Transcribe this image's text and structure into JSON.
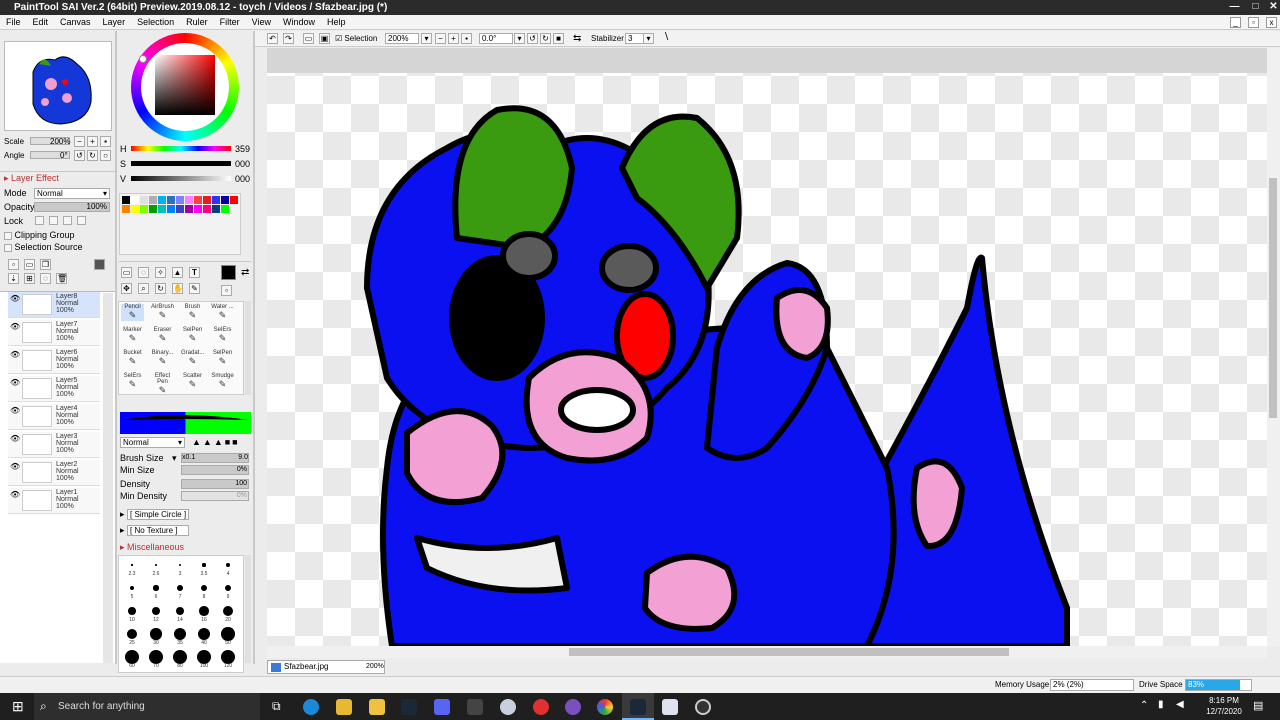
{
  "window": {
    "title": "PaintTool SAI Ver.2 (64bit) Preview.2019.08.12 - toych / Videos / Sfazbear.jpg (*)"
  },
  "menu": [
    "File",
    "Edit",
    "Canvas",
    "Layer",
    "Selection",
    "Ruler",
    "Filter",
    "View",
    "Window",
    "Help"
  ],
  "toolbar": {
    "selection_label": "Selection",
    "zoom": "200%",
    "rotation": "0.0°",
    "stabilizer_label": "Stabilizer",
    "stabilizer_value": "3"
  },
  "navigator": {
    "scale_label": "Scale",
    "scale_value": "200%",
    "angle_label": "Angle",
    "angle_value": "0°"
  },
  "layer_panel": {
    "layer_effect": "Layer Effect",
    "mode_label": "Mode",
    "mode_value": "Normal",
    "opacity_label": "Opacity",
    "opacity_value": "100%",
    "lock_label": "Lock",
    "clipping_group": "Clipping Group",
    "selection_source": "Selection Source",
    "layers": [
      {
        "name": "Layer8",
        "mode": "Normal",
        "opacity": "100%"
      },
      {
        "name": "Layer7",
        "mode": "Normal",
        "opacity": "100%"
      },
      {
        "name": "Layer6",
        "mode": "Normal",
        "opacity": "100%"
      },
      {
        "name": "Layer5",
        "mode": "Normal",
        "opacity": "100%"
      },
      {
        "name": "Layer4",
        "mode": "Normal",
        "opacity": "100%"
      },
      {
        "name": "Layer3",
        "mode": "Normal",
        "opacity": "100%"
      },
      {
        "name": "Layer2",
        "mode": "Normal",
        "opacity": "100%"
      },
      {
        "name": "Layer1",
        "mode": "Normal",
        "opacity": "100%"
      }
    ]
  },
  "color": {
    "h_label": "H",
    "h_value": "359",
    "s_label": "S",
    "s_value": "000",
    "v_label": "V",
    "v_value": "000"
  },
  "swatches": [
    "#000000",
    "#ffffff",
    "#e0e0e0",
    "#b0b0b0",
    "#00b0f0",
    "#3070c0",
    "#8080ff",
    "#ff80ff",
    "#ff4040",
    "#e02020",
    "#3030ff",
    "#0000a0",
    "#ff0000",
    "#ff8000",
    "#ffff00",
    "#80ff00",
    "#00a000",
    "#00c0c0",
    "#0080ff",
    "#4040c0",
    "#a000a0",
    "#ff00ff",
    "#ff0080",
    "#004080",
    "#00ff00"
  ],
  "tools": [
    {
      "name": "Pencil"
    },
    {
      "name": "AirBrush"
    },
    {
      "name": "Brush"
    },
    {
      "name": "Water ..."
    },
    {
      "name": "Marker"
    },
    {
      "name": "Eraser"
    },
    {
      "name": "SelPen"
    },
    {
      "name": "SelErs"
    },
    {
      "name": "Bucket"
    },
    {
      "name": "Binary..."
    },
    {
      "name": "Gradat..."
    },
    {
      "name": "SelPen"
    },
    {
      "name": "SelErs"
    },
    {
      "name": "Effect Pen"
    },
    {
      "name": "Scatter"
    },
    {
      "name": "Smudge"
    }
  ],
  "brush": {
    "mode_value": "Normal",
    "size_label": "Brush Size",
    "size_mult": "x0.1",
    "size_value": "9.0",
    "min_size_label": "Min Size",
    "min_size_value": "0%",
    "density_label": "Density",
    "density_value": "100",
    "min_density_label": "Min Density",
    "min_density_value": "0%",
    "shape": "[ Simple Circle ]",
    "texture": "[ No Texture ]",
    "misc": "Miscellaneous"
  },
  "brush_sizes": [
    "2.3",
    "2.6",
    "3",
    "3.5",
    "4",
    "5",
    "6",
    "7",
    "8",
    "9",
    "10",
    "12",
    "14",
    "16",
    "20",
    "25",
    "30",
    "35",
    "40",
    "50",
    "60",
    "70",
    "80",
    "100",
    "120"
  ],
  "doc_tab": {
    "name": "Sfazbear.jpg",
    "zoom": "200%"
  },
  "status": {
    "memory_label": "Memory Usage",
    "memory_value": "2% (2%)",
    "drive_label": "Drive Space",
    "drive_value": "83%"
  },
  "taskbar": {
    "search_placeholder": "Search for anything",
    "time": "8:16 PM",
    "date": "12/7/2020"
  }
}
